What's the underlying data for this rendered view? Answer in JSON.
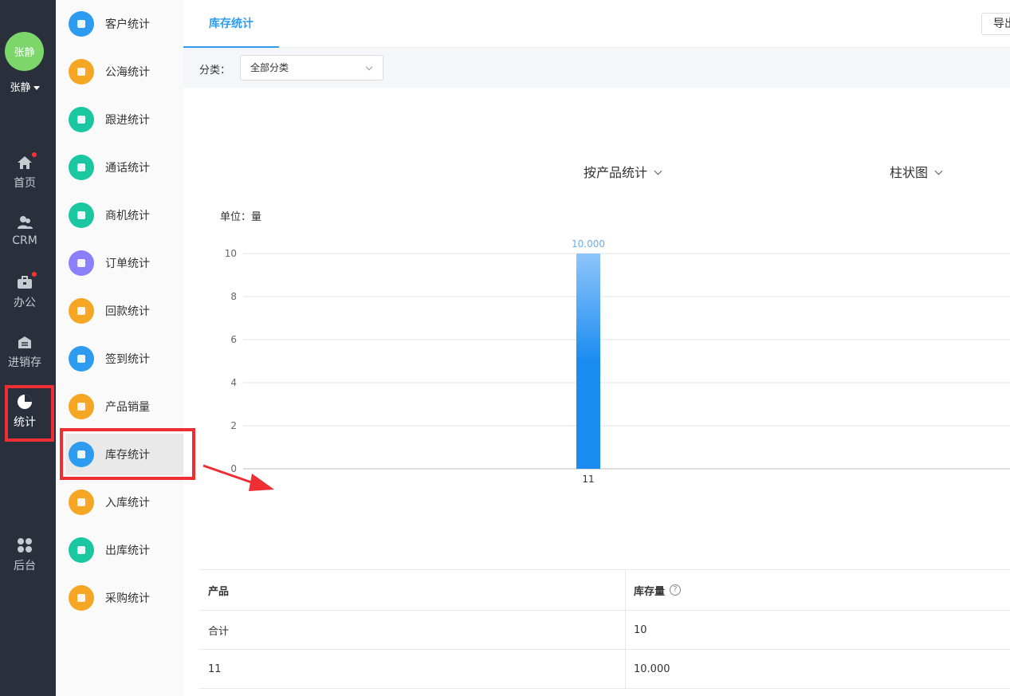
{
  "user": {
    "avatar_text": "张静",
    "name": "张静"
  },
  "rail": {
    "items": [
      {
        "label": "首页",
        "icon": "home-icon",
        "badge": true
      },
      {
        "label": "CRM",
        "icon": "users-icon",
        "badge": false
      },
      {
        "label": "办公",
        "icon": "briefcase-icon",
        "badge": true
      },
      {
        "label": "进销存",
        "icon": "warehouse-icon",
        "badge": false
      },
      {
        "label": "统计",
        "icon": "pie-chart-icon",
        "badge": false,
        "active": true
      },
      {
        "label": "后台",
        "icon": "grid-icon",
        "badge": false
      }
    ]
  },
  "submenu": {
    "items": [
      {
        "label": "客户统计",
        "color": "#2d9cf0"
      },
      {
        "label": "公海统计",
        "color": "#f5a623"
      },
      {
        "label": "跟进统计",
        "color": "#1bc7a0"
      },
      {
        "label": "通话统计",
        "color": "#1bc7a0"
      },
      {
        "label": "商机统计",
        "color": "#1bc7a0"
      },
      {
        "label": "订单统计",
        "color": "#8b80f9"
      },
      {
        "label": "回款统计",
        "color": "#f5a623"
      },
      {
        "label": "签到统计",
        "color": "#2d9cf0"
      },
      {
        "label": "产品销量",
        "color": "#f5a623"
      },
      {
        "label": "库存统计",
        "color": "#2d9cf0",
        "active": true
      },
      {
        "label": "入库统计",
        "color": "#f5a623"
      },
      {
        "label": "出库统计",
        "color": "#1bc7a0"
      },
      {
        "label": "采购统计",
        "color": "#f5a623"
      }
    ]
  },
  "tabs": {
    "active_label": "库存统计",
    "export_label": "导出"
  },
  "filter": {
    "label": "分类：",
    "value": "全部分类"
  },
  "chart_controls": {
    "group_by": "按产品统计",
    "chart_type": "柱状图",
    "unit": "单位：量"
  },
  "chart_data": {
    "type": "bar",
    "categories": [
      "11"
    ],
    "values": [
      10
    ],
    "data_labels": [
      "10.000"
    ],
    "title": "",
    "xlabel": "",
    "ylabel": "",
    "ylim": [
      0,
      10
    ],
    "yticks": [
      0,
      2,
      4,
      6,
      8,
      10
    ],
    "grid": true,
    "bar_color_top": "#8ec5fb",
    "bar_color_bottom": "#1a8cf0"
  },
  "table": {
    "headers": [
      "产品",
      "库存量"
    ],
    "rows": [
      [
        "合计",
        "10"
      ],
      [
        "11",
        "10.000"
      ]
    ]
  },
  "colors": {
    "accent": "#2d9cf0",
    "highlight": "#ee2e33",
    "rail_bg": "#2a2f3c"
  }
}
